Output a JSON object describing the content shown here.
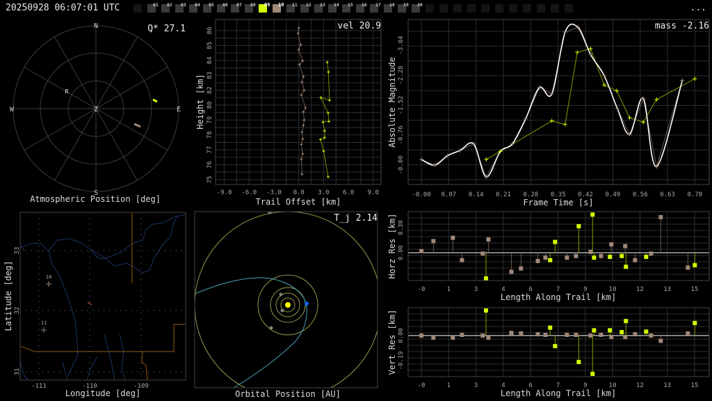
{
  "header": {
    "title": "20250928 06:07:01 UTC",
    "more_label": "...",
    "frames": [
      "01",
      "02",
      "03",
      "04",
      "05",
      "06",
      "07",
      "08",
      "09",
      "10",
      "11",
      "12",
      "13",
      "14",
      "15",
      "16",
      "17",
      "18",
      "19",
      "20"
    ],
    "active_frames": {
      "09": "#d4ff00",
      "10": "#a08878"
    }
  },
  "colors": {
    "station_a": "#d4ff00",
    "station_b": "#a08878",
    "fit": "#ffffff",
    "grid": "#2e2e2e"
  },
  "polar": {
    "title": "Atmospheric Position [deg]",
    "stat_label": "Q* 27.1",
    "compass": {
      "n": "N",
      "s": "S",
      "e": "E",
      "w": "W",
      "zenith": "Z"
    },
    "radiant_label": "R"
  },
  "height_plot": {
    "stat_label": "vel 20.9",
    "xlabel": "Trail Offset [km]",
    "ylabel": "Height [km]",
    "xticks": [
      "-9.0",
      "-6.0",
      "-3.0",
      "0.0",
      "3.0",
      "6.0",
      "9.0"
    ],
    "yticks": [
      "86",
      "85",
      "84",
      "83",
      "82",
      "80",
      "79",
      "78",
      "77",
      "76",
      "75"
    ]
  },
  "light_curve": {
    "stat_label": "mass -2.16",
    "xlabel": "Frame Time [s]",
    "ylabel": "Absolute Magnitude",
    "xticks": [
      "-0.00",
      "0.07",
      "0.14",
      "0.21",
      "0.28",
      "0.35",
      "0.42",
      "0.49",
      "0.56",
      "0.63",
      "0.70"
    ],
    "yticks": [
      "-3.04",
      "-2.28",
      "-1.52",
      "-0.76",
      "-0.00"
    ]
  },
  "horz_res": {
    "xlabel": "Length Along Trail [km]",
    "ylabel": "Horz Res [km]",
    "yticks": [
      "0.30",
      "0.00"
    ]
  },
  "vert_res": {
    "xlabel": "Length Along Trail [km]",
    "ylabel": "Vert Res [km]",
    "yticks": [
      "0.00",
      "-0.19"
    ]
  },
  "res_xticks": [
    "-0",
    "1",
    "3",
    "4",
    "6",
    "7",
    "9",
    "10",
    "12",
    "13",
    "15"
  ],
  "map": {
    "xlabel": "Longitude [deg]",
    "ylabel": "Latitude [deg]",
    "xticks": [
      "-111",
      "-110",
      "-109"
    ],
    "yticks": [
      "33",
      "32",
      "31"
    ],
    "stations": [
      {
        "label": "10"
      },
      {
        "label": "11"
      }
    ]
  },
  "orbit": {
    "xlabel": "Orbital Position [AU]",
    "stat_label": "T_j 2.14"
  },
  "chart_data": [
    {
      "type": "line",
      "name": "trail-offset",
      "xlabel": "Trail Offset [km]",
      "ylabel": "Height [km]",
      "xlim": [
        -10,
        10
      ],
      "ylim": [
        74.4,
        86.8
      ],
      "series": [
        {
          "name": "station-10",
          "points": [
            [
              0.0,
              86.2
            ],
            [
              -0.08,
              85.8
            ],
            [
              0.22,
              84.96
            ],
            [
              0.0,
              84.6
            ],
            [
              0.47,
              83.77
            ],
            [
              0.08,
              83.5
            ],
            [
              0.56,
              82.6
            ],
            [
              0.39,
              82.2
            ],
            [
              0.65,
              81.6
            ],
            [
              0.31,
              81.25
            ],
            [
              0.82,
              80.3
            ],
            [
              0.56,
              80.0
            ],
            [
              0.65,
              79.4
            ],
            [
              0.56,
              79.0
            ],
            [
              0.39,
              78.5
            ],
            [
              0.47,
              78.0
            ],
            [
              0.31,
              77.6
            ],
            [
              0.47,
              76.9
            ],
            [
              0.31,
              76.5
            ],
            [
              0.39,
              75.4
            ]
          ]
        },
        {
          "name": "station-09",
          "points": [
            [
              3.44,
              83.67
            ],
            [
              3.58,
              82.95
            ],
            [
              3.72,
              80.86
            ],
            [
              2.67,
              81.05
            ],
            [
              3.55,
              79.92
            ],
            [
              3.64,
              79.3
            ],
            [
              2.93,
              79.25
            ],
            [
              3.13,
              78.6
            ],
            [
              3.13,
              78.1
            ],
            [
              2.62,
              77.96
            ],
            [
              3.01,
              77.1
            ],
            [
              3.55,
              75.2
            ]
          ]
        }
      ]
    },
    {
      "type": "line",
      "name": "light-curve",
      "xlabel": "Frame Time [s]",
      "ylabel": "Absolute Magnitude",
      "xlim": [
        -0.035,
        0.738
      ],
      "ylim": [
        0.3,
        -2.8
      ],
      "series": [
        {
          "name": "station-10",
          "points": [
            [
              0.0,
              -0.107
            ],
            [
              0.034,
              0.004
            ],
            [
              0.067,
              -0.18
            ],
            [
              0.099,
              -0.28
            ],
            [
              0.134,
              -0.405
            ],
            [
              0.166,
              0.23
            ],
            [
              0.202,
              -0.26
            ],
            [
              0.233,
              -0.405
            ],
            [
              0.267,
              -0.89
            ],
            [
              0.302,
              -1.49
            ],
            [
              0.334,
              -1.37
            ],
            [
              0.368,
              -2.56
            ],
            [
              0.401,
              -2.65
            ],
            [
              0.433,
              -2.13
            ],
            [
              0.468,
              -1.72
            ],
            [
              0.502,
              -1.08
            ],
            [
              0.533,
              -0.59
            ],
            [
              0.568,
              -1.28
            ],
            [
              0.602,
              0.03
            ],
            [
              0.668,
              -1.63
            ]
          ]
        },
        {
          "name": "station-09",
          "points": [
            [
              0.166,
              -0.107
            ],
            [
              0.202,
              -0.263
            ],
            [
              0.334,
              -0.85
            ],
            [
              0.368,
              -0.78
            ],
            [
              0.399,
              -2.17
            ],
            [
              0.433,
              -2.24
            ],
            [
              0.468,
              -1.54
            ],
            [
              0.5,
              -1.43
            ],
            [
              0.533,
              -0.91
            ],
            [
              0.568,
              -0.825
            ],
            [
              0.602,
              -1.26
            ],
            [
              0.7,
              -1.66
            ]
          ]
        }
      ]
    },
    {
      "type": "scatter",
      "name": "horizontal-residuals",
      "xlabel": "Length Along Trail [km]",
      "ylabel": "Horz Res [km]",
      "xlim": [
        -0.75,
        15.8
      ],
      "ylim": [
        -0.34,
        0.5
      ],
      "series": [
        {
          "name": "station-10",
          "points": [
            [
              0,
              0.02
            ],
            [
              0.66,
              0.14
            ],
            [
              1.73,
              0.18
            ],
            [
              2.23,
              -0.09
            ],
            [
              3.37,
              -0.01
            ],
            [
              3.68,
              0.16
            ],
            [
              4.94,
              -0.23
            ],
            [
              5.47,
              -0.19
            ],
            [
              6.39,
              -0.1
            ],
            [
              6.81,
              -0.06
            ],
            [
              7.99,
              -0.06
            ],
            [
              8.49,
              -0.04
            ],
            [
              9.29,
              0.01
            ],
            [
              9.86,
              -0.04
            ],
            [
              10.43,
              0.1
            ],
            [
              11.19,
              0.08
            ],
            [
              11.73,
              -0.09
            ],
            [
              12.61,
              -0.01
            ],
            [
              13.14,
              0.43
            ],
            [
              14.63,
              -0.18
            ]
          ]
        },
        {
          "name": "station-09",
          "points": [
            [
              3.55,
              -0.31
            ],
            [
              7.07,
              -0.09
            ],
            [
              7.34,
              0.13
            ],
            [
              8.64,
              0.32
            ],
            [
              9.4,
              0.46
            ],
            [
              9.48,
              -0.06
            ],
            [
              10.35,
              -0.05
            ],
            [
              11.0,
              -0.04
            ],
            [
              11.23,
              -0.17
            ],
            [
              12.34,
              -0.05
            ],
            [
              15.01,
              -0.15
            ]
          ]
        }
      ]
    },
    {
      "type": "scatter",
      "name": "vertical-residuals",
      "xlabel": "Length Along Trail [km]",
      "ylabel": "Vert Res [km]",
      "xlim": [
        -0.75,
        15.8
      ],
      "ylim": [
        -0.31,
        0.215
      ],
      "series": [
        {
          "name": "station-10",
          "points": [
            [
              0,
              0
            ],
            [
              0.66,
              -0.016
            ],
            [
              1.73,
              -0.016
            ],
            [
              2.23,
              0.005
            ],
            [
              3.37,
              0
            ],
            [
              3.68,
              -0.016
            ],
            [
              4.94,
              0.02
            ],
            [
              5.47,
              0.016
            ],
            [
              6.39,
              0.01
            ],
            [
              6.81,
              0.005
            ],
            [
              7.99,
              0.005
            ],
            [
              8.49,
              0.005
            ],
            [
              9.29,
              0
            ],
            [
              9.86,
              0.005
            ],
            [
              10.43,
              -0.01
            ],
            [
              11.19,
              -0.01
            ],
            [
              11.73,
              0.01
            ],
            [
              12.61,
              0
            ],
            [
              13.14,
              -0.04
            ],
            [
              14.63,
              0.016
            ]
          ]
        },
        {
          "name": "station-09",
          "points": [
            [
              3.55,
              0.19
            ],
            [
              7.07,
              0.06
            ],
            [
              7.34,
              -0.08
            ],
            [
              8.64,
              -0.2
            ],
            [
              9.4,
              -0.29
            ],
            [
              9.48,
              0.04
            ],
            [
              10.35,
              0.04
            ],
            [
              11.0,
              0.026
            ],
            [
              11.23,
              0.11
            ],
            [
              12.34,
              0.03
            ],
            [
              15.01,
              0.095
            ]
          ]
        }
      ]
    }
  ]
}
